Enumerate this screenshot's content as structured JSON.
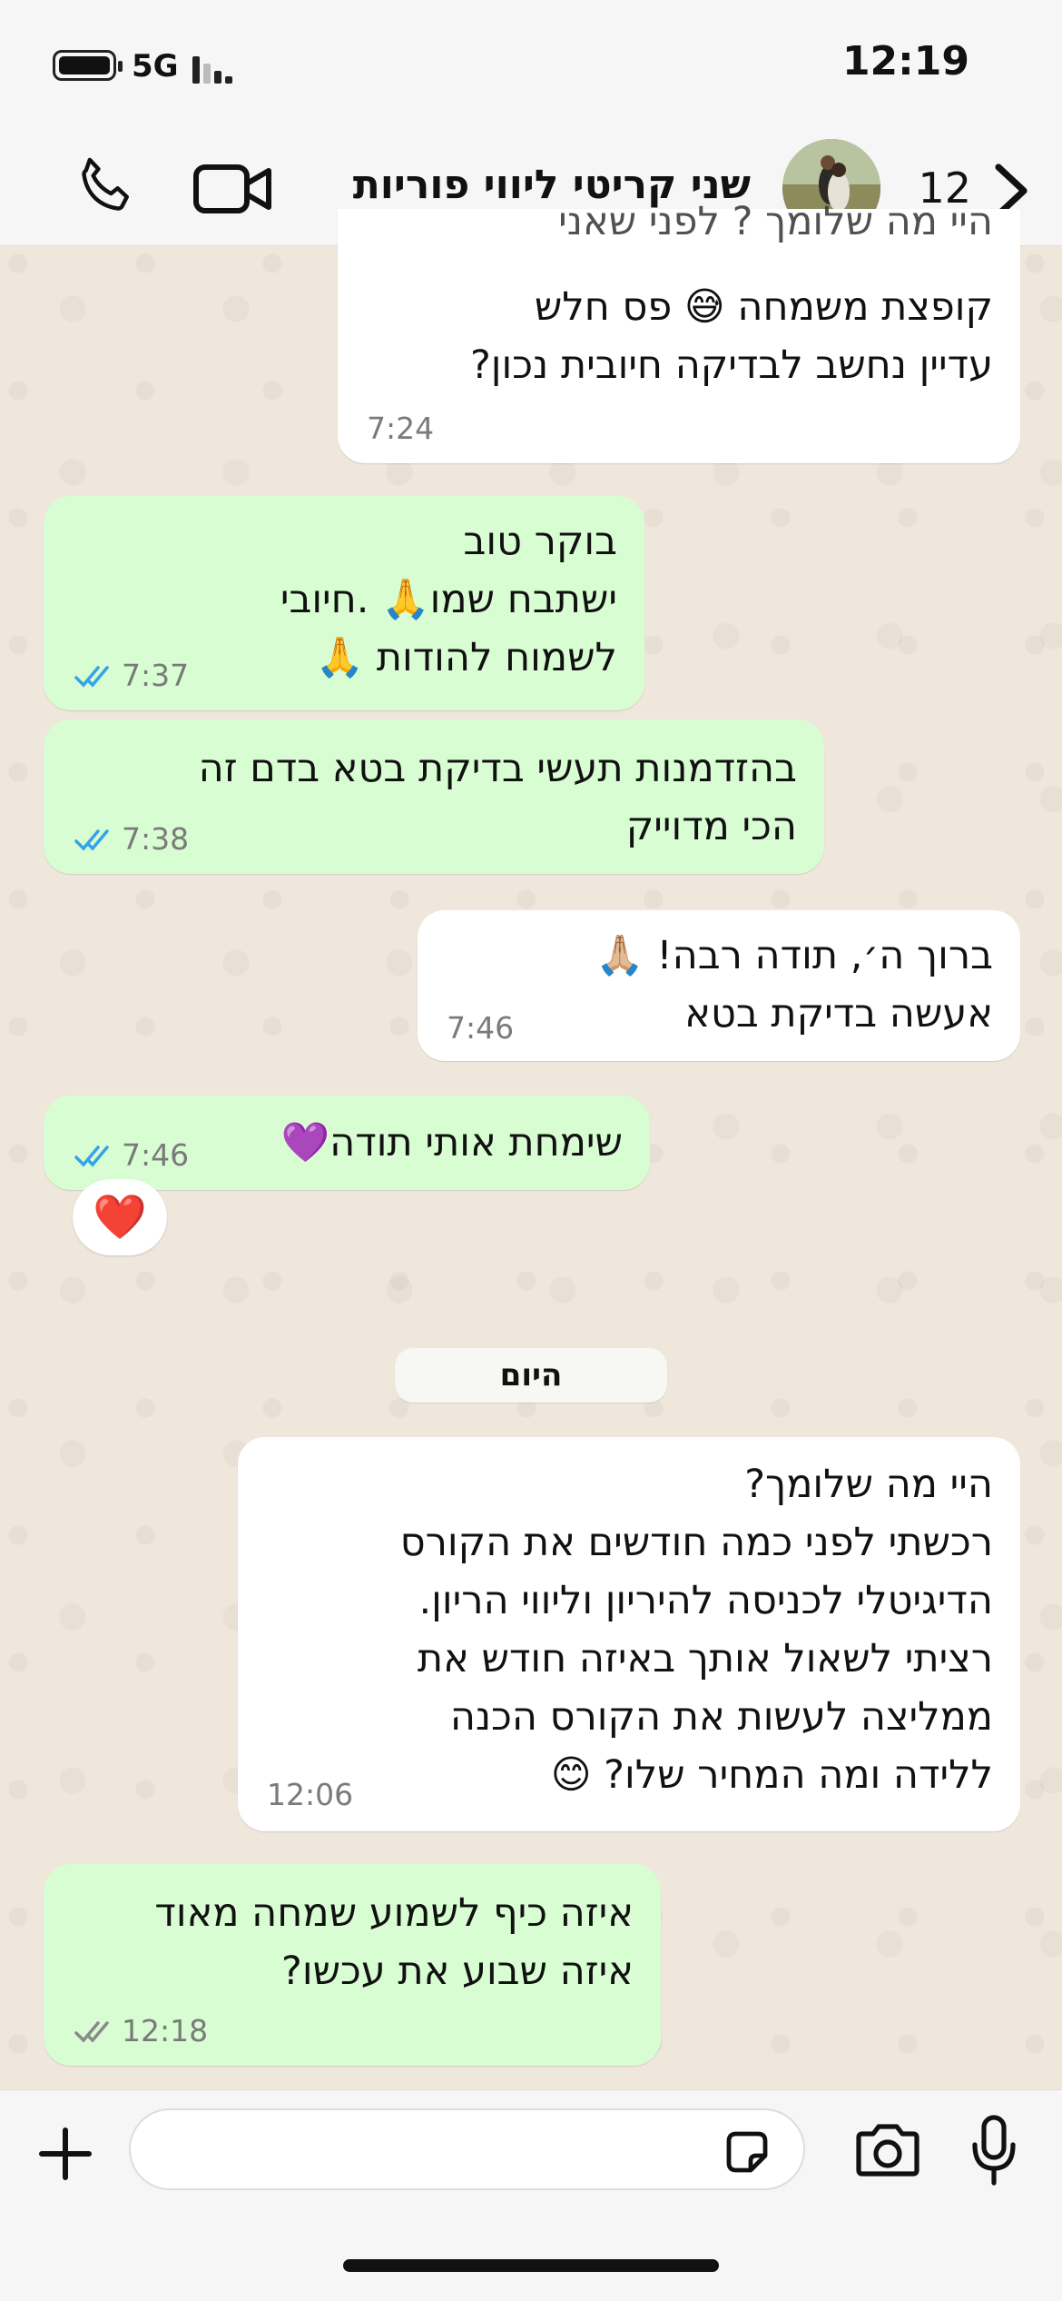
{
  "status_bar": {
    "time": "12:19",
    "network": "5G"
  },
  "header": {
    "back_count": "12",
    "contact_name": "שני קריטי ליווי פוריות",
    "icons": [
      "back-chevron-icon",
      "video-camera-icon",
      "phone-icon"
    ]
  },
  "messages": [
    {
      "direction": "incoming",
      "text": "קופצת משמחה 😅 פס חלש\nעדיין נחשב לבדיקה חיובית נכון?",
      "partial_top_text": "היי מה שלומך ? לפני שאני",
      "time": "7:24"
    },
    {
      "direction": "outgoing",
      "text": "בוקר טוב\nישתבח שמו🙏 .חיובי\nלשמוח להודות 🙏",
      "time": "7:37",
      "status": "read"
    },
    {
      "direction": "outgoing",
      "text": "בהזדמנות תעשי בדיקת בטא בדם זה\nהכי מדוייק",
      "time": "7:38",
      "status": "read"
    },
    {
      "direction": "incoming",
      "text": "ברוך ה׳, תודה רבה! 🙏🏼\nאעשה בדיקת בטא",
      "time": "7:46"
    },
    {
      "direction": "outgoing",
      "text": "שימחת אותי תודה💜",
      "time": "7:46",
      "status": "read",
      "reaction": "❤️"
    },
    {
      "direction": "incoming",
      "text": "היי מה שלומך?\nרכשתי לפני כמה חודשים את הקורס\nהדיגיטלי לכניסה להיריון וליווי הריון.\nרציתי לשאול אותך באיזה חודש את\nממליצה לעשות את הקורס הכנה\nללידה ומה המחיר שלו? 😊",
      "time": "12:06"
    },
    {
      "direction": "outgoing",
      "text": "איזה כיף לשמוע שמחה מאוד\nאיזה שבוע את עכשו?",
      "time": "12:18",
      "status": "delivered"
    }
  ],
  "date_separator": "היום",
  "composer": {
    "input_value": "",
    "icons": [
      "plus-icon",
      "sticker-icon",
      "camera-icon",
      "microphone-icon"
    ]
  },
  "colors": {
    "outgoing_bubble": "#d9fdd3",
    "incoming_bubble": "#ffffff",
    "read_ticks": "#34a3e8",
    "delivered_ticks": "#8a8a8a"
  }
}
